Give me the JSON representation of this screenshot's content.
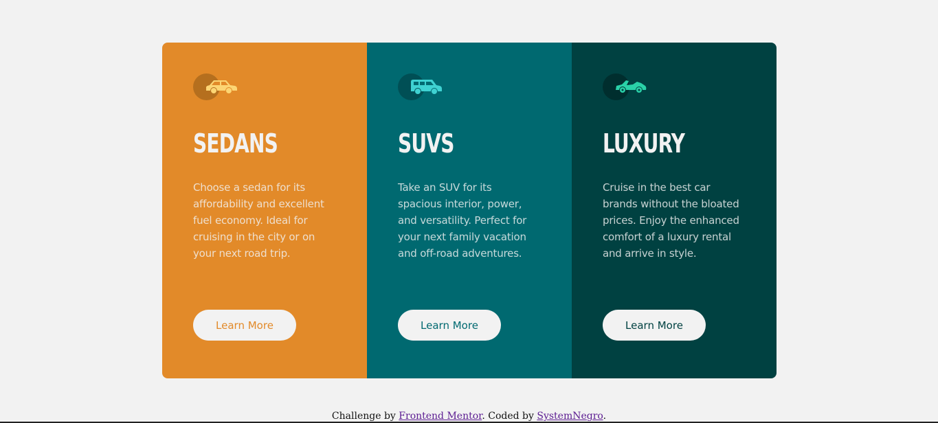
{
  "cards": [
    {
      "title": "Sedans",
      "text": "Choose a sedan for its affordability and excellent fuel economy. Ideal for cruising in the city or on your next road trip.",
      "button_label": "Learn More",
      "icon": "sedan-car-icon",
      "color": "#e28a29"
    },
    {
      "title": "SUVs",
      "text": "Take an SUV for its spacious interior, power, and versatility. Perfect for your next family vacation and off-road adventures.",
      "button_label": "Learn More",
      "icon": "suv-car-icon",
      "color": "#006970"
    },
    {
      "title": "Luxury",
      "text": "Cruise in the best car brands without the bloated prices. Enjoy the enhanced comfort of a luxury rental and arrive in style.",
      "button_label": "Learn More",
      "icon": "luxury-car-icon",
      "color": "#004141"
    }
  ],
  "attribution": {
    "prefix": "Challenge by ",
    "mentor_link": "Frontend Mentor",
    "middle": ". Coded by ",
    "author_link": "SystemNegro",
    "suffix": "."
  }
}
